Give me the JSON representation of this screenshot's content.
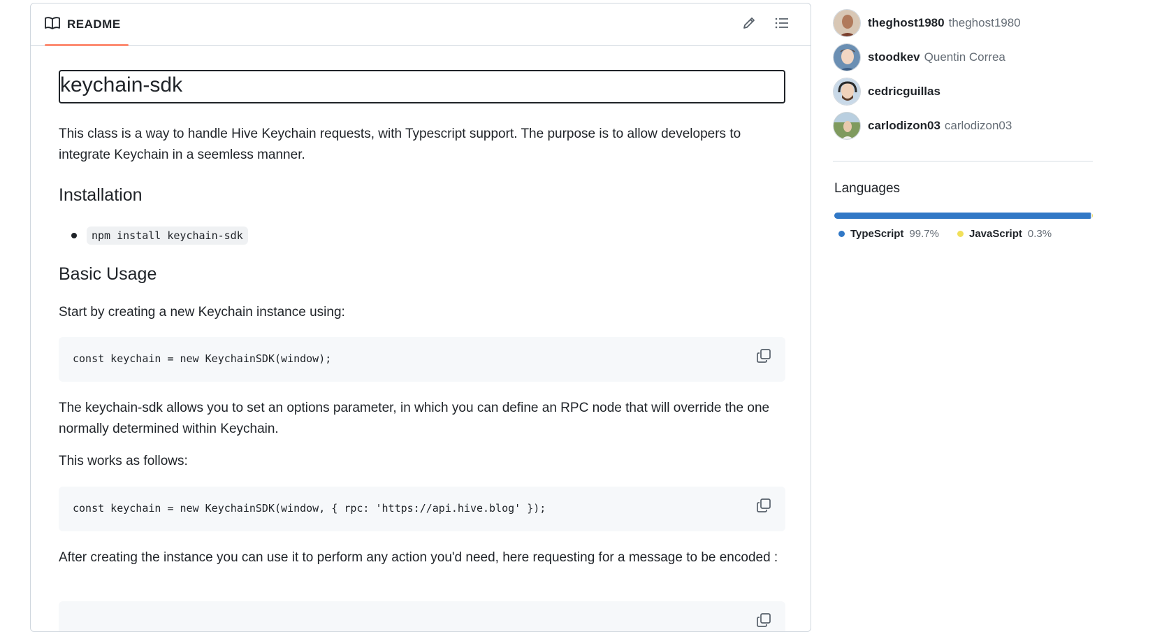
{
  "readme": {
    "tab_label": "README",
    "title": "keychain-sdk",
    "intro": "This class is a way to handle Hive Keychain requests, with Typescript support. The purpose is to allow developers to integrate Keychain in a seemless manner.",
    "installation_heading": "Installation",
    "install_command": "npm install keychain-sdk",
    "basic_usage_heading": "Basic Usage",
    "start_text": "Start by creating a new Keychain instance using:",
    "code1": "const keychain = new KeychainSDK(window);",
    "options_text": "The keychain-sdk allows you to set an options parameter, in which you can define an RPC node that will override the one normally determined within Keychain.",
    "works_text": "This works as follows:",
    "code2": "const keychain = new KeychainSDK(window, { rpc: 'https://api.hive.blog' });",
    "after_text": "After creating the instance you can use it to perform any action you'd need, here requesting for a message to be encoded :"
  },
  "contributors": [
    {
      "login": "theghost1980",
      "name": "theghost1980"
    },
    {
      "login": "stoodkev",
      "name": "Quentin Correa"
    },
    {
      "login": "cedricguillas",
      "name": ""
    },
    {
      "login": "carlodizon03",
      "name": "carlodizon03"
    }
  ],
  "languages": {
    "heading": "Languages",
    "items": [
      {
        "name": "TypeScript",
        "percent": "99.7%",
        "fraction": 0.997,
        "color": "#3178c6"
      },
      {
        "name": "JavaScript",
        "percent": "0.3%",
        "fraction": 0.003,
        "color": "#f1e05a"
      }
    ]
  },
  "icons": {
    "tab_icon": "book-icon",
    "edit": "pencil-icon",
    "outline": "list-icon",
    "copy": "copy-icon"
  }
}
